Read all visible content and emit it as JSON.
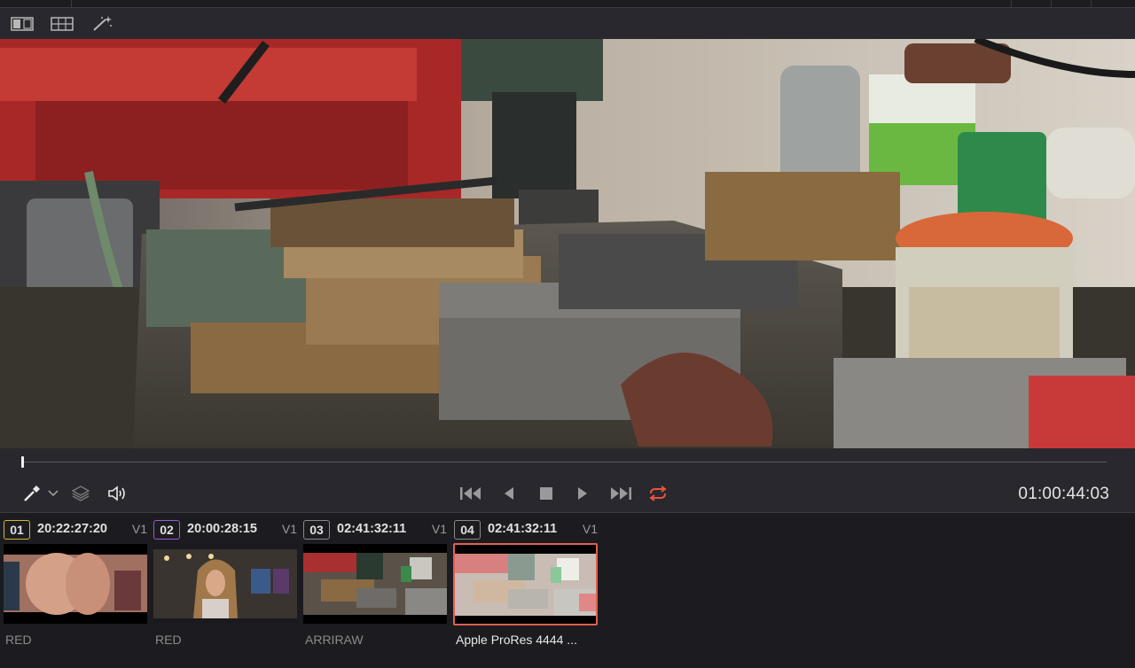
{
  "toolbar": {
    "icons": [
      "viewer-mode-icon",
      "split-screen-icon",
      "magic-wand-icon"
    ]
  },
  "playback": {
    "timecode": "01:00:44:03",
    "progress": 0.001,
    "icons": [
      "color-picker-icon",
      "chevron-down-icon",
      "layers-icon",
      "speaker-icon",
      "skip-to-start-icon",
      "step-back-icon",
      "stop-icon",
      "play-icon",
      "skip-to-end-icon",
      "loop-icon"
    ],
    "loop_color": "#e8533f"
  },
  "clips": [
    {
      "number": "01",
      "timecode": "20:22:27:20",
      "track": "V1",
      "codec": "RED",
      "badge_color": "#d6b82b",
      "selected": false
    },
    {
      "number": "02",
      "timecode": "20:00:28:15",
      "track": "V1",
      "codec": "RED",
      "badge_color": "#9b5ad6",
      "selected": false
    },
    {
      "number": "03",
      "timecode": "02:41:32:11",
      "track": "V1",
      "codec": "ARRIRAW",
      "badge_color": "#8a8a8a",
      "selected": false
    },
    {
      "number": "04",
      "timecode": "02:41:32:11",
      "track": "V1",
      "codec": "Apple ProRes 4444 ...",
      "badge_color": "#8a8a8a",
      "selected": true
    }
  ],
  "colors": {
    "selection": "#e06050",
    "background": "#28282e",
    "strip_background": "#1c1c20"
  }
}
